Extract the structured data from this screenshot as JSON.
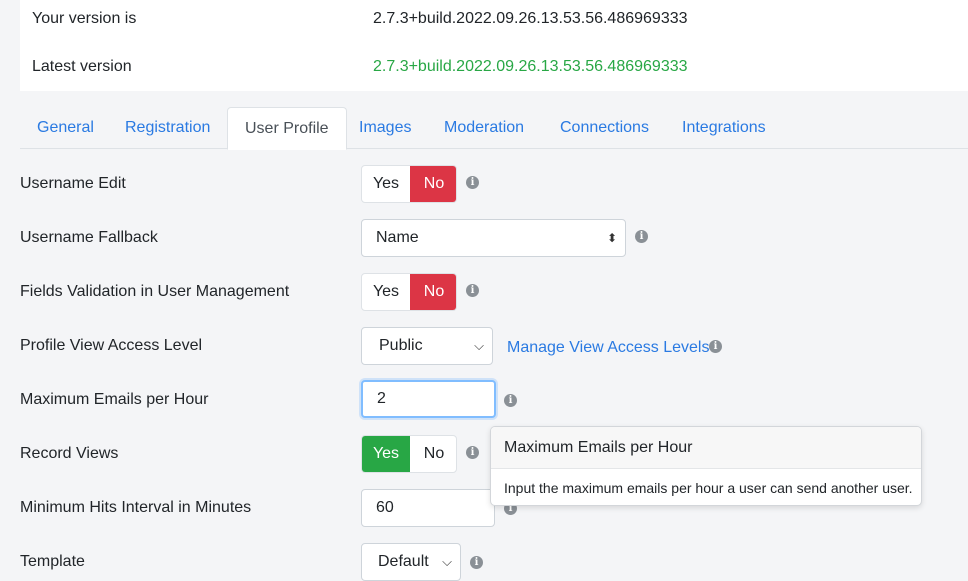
{
  "version": {
    "current_label": "Your version is",
    "current_value": "2.7.3+build.2022.09.26.13.53.56.486969333",
    "latest_label": "Latest version",
    "latest_value": "2.7.3+build.2022.09.26.13.53.56.486969333",
    "latest_color": "#28a745"
  },
  "tabs": [
    {
      "label": "General"
    },
    {
      "label": "Registration"
    },
    {
      "label": "User Profile",
      "active": true
    },
    {
      "label": "Images"
    },
    {
      "label": "Moderation"
    },
    {
      "label": "Connections"
    },
    {
      "label": "Integrations"
    }
  ],
  "fields": {
    "username_edit": {
      "label": "Username Edit",
      "yes": "Yes",
      "no": "No",
      "selected": "No"
    },
    "username_fallback": {
      "label": "Username Fallback",
      "value": "Name"
    },
    "fields_validation": {
      "label": "Fields Validation in User Management",
      "yes": "Yes",
      "no": "No",
      "selected": "No"
    },
    "profile_view_access": {
      "label": "Profile View Access Level",
      "value": "Public",
      "link": "Manage View Access Levels"
    },
    "max_emails": {
      "label": "Maximum Emails per Hour",
      "value": "2"
    },
    "record_views": {
      "label": "Record Views",
      "yes": "Yes",
      "no": "No",
      "selected": "Yes"
    },
    "min_hits": {
      "label": "Minimum Hits Interval in Minutes",
      "value": "60"
    },
    "template": {
      "label": "Template",
      "value": "Default"
    }
  },
  "popover": {
    "title": "Maximum Emails per Hour",
    "body": "Input the maximum emails per hour a user can send another user."
  },
  "colors": {
    "accent": "#2a7ae2",
    "danger": "#dc3545",
    "success": "#28a745"
  },
  "icons": {
    "info": "info-circle-icon",
    "select_caret": "sort-caret-icon",
    "chevron": "chevron-down-icon"
  }
}
